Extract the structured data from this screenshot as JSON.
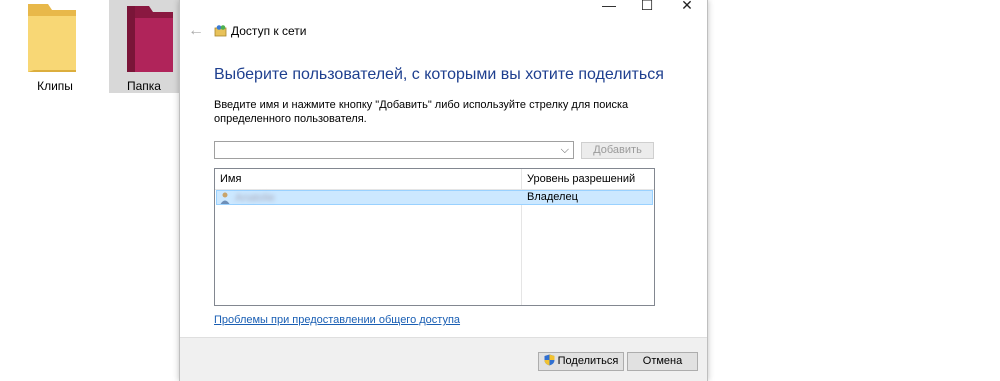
{
  "desktop": {
    "icons": [
      {
        "label": "Клипы"
      },
      {
        "label": "Папка"
      }
    ]
  },
  "window": {
    "controls": {
      "minimize": "—",
      "maximize": "☐",
      "close": "✕"
    },
    "back": "←",
    "title": "Доступ к сети",
    "heading": "Выберите пользователей, с которыми вы хотите поделиться",
    "instruction": "Введите имя и нажмите кнопку \"Добавить\" либо используйте стрелку для поиска определенного пользователя.",
    "combo": {
      "value": "",
      "arrow": "⌵"
    },
    "add_button": "Добавить",
    "list": {
      "columns": [
        "Имя",
        "Уровень разрешений"
      ],
      "rows": [
        {
          "name": "Anatolie",
          "permission": "Владелец"
        }
      ]
    },
    "help_link": "Проблемы при предоставлении общего доступа",
    "share_button": "Поделиться",
    "cancel_button": "Отмена"
  },
  "colors": {
    "heading": "#1e3f8f",
    "link": "#1a5fb4",
    "selection": "#cce8ff",
    "folder_yellow": "#f8d775",
    "folder_crimson": "#b0245a"
  }
}
